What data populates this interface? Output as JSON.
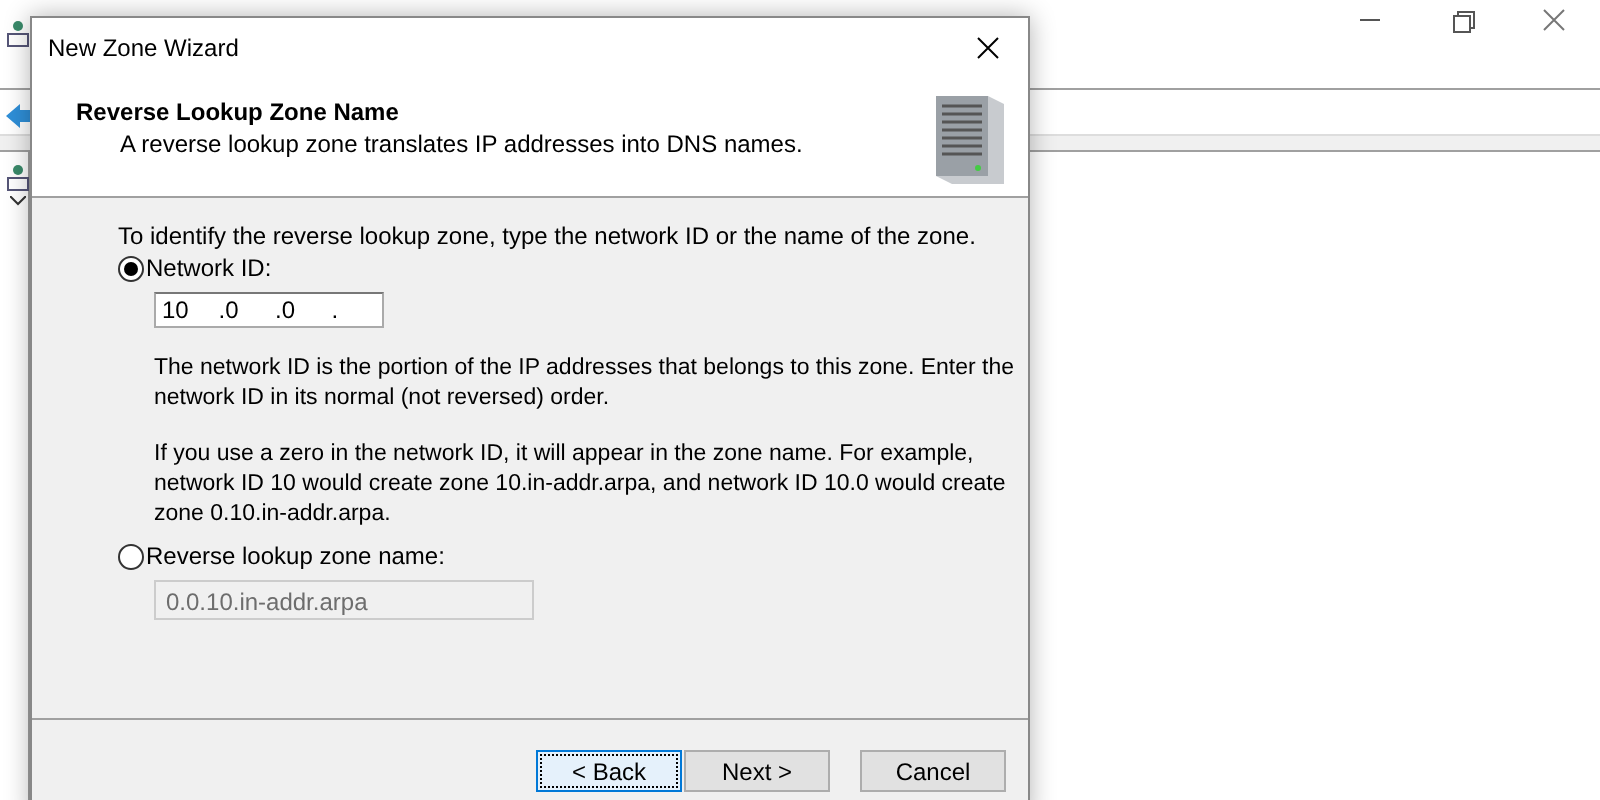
{
  "dialog": {
    "title": "New Zone Wizard",
    "header": {
      "title": "Reverse Lookup Zone Name",
      "subtitle": "A reverse lookup zone translates IP addresses into DNS names."
    },
    "intro": "To identify the reverse lookup zone, type the network ID or the name of the zone.",
    "options": [
      {
        "kind": "network_id",
        "label": "Network ID:",
        "selected": true,
        "segments": [
          "10",
          ".0",
          ".0",
          "."
        ],
        "notes": [
          "The network ID is the portion of the IP addresses that belongs to this zone. Enter the network ID in its normal (not reversed) order.",
          "If you use a zero in the network ID, it will appear in the zone name. For example, network ID 10 would create zone 10.in-addr.arpa, and network ID 10.0 would create zone 0.10.in-addr.arpa."
        ]
      },
      {
        "kind": "zone_name",
        "label": "Reverse lookup zone name:",
        "selected": false,
        "value": "0.0.10.in-addr.arpa",
        "disabled": true
      }
    ],
    "buttons": [
      {
        "label": "< Back",
        "focused": true
      },
      {
        "label": "Next >",
        "focused": false
      },
      {
        "label": "Cancel",
        "focused": false
      }
    ]
  }
}
